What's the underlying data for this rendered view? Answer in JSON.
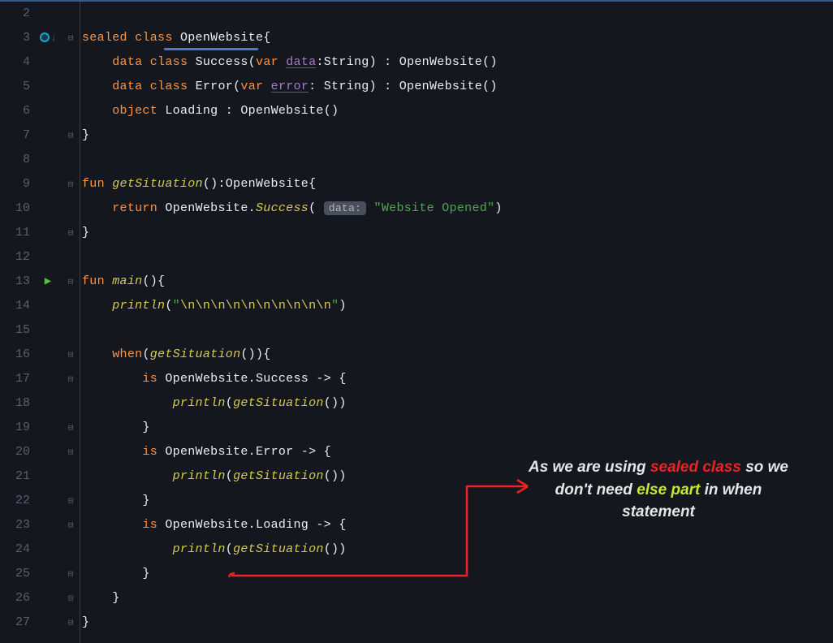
{
  "lines": [
    {
      "num": 2,
      "run": "",
      "fold": "",
      "code": ""
    },
    {
      "num": 3,
      "run": "impl",
      "fold": "open",
      "code": "sealed"
    },
    {
      "num": 4,
      "run": "",
      "fold": "",
      "code": "success"
    },
    {
      "num": 5,
      "run": "",
      "fold": "",
      "code": "error"
    },
    {
      "num": 6,
      "run": "",
      "fold": "",
      "code": "loading"
    },
    {
      "num": 7,
      "run": "",
      "fold": "close",
      "code": "brace"
    },
    {
      "num": 8,
      "run": "",
      "fold": "",
      "code": ""
    },
    {
      "num": 9,
      "run": "",
      "fold": "open",
      "code": "getsit"
    },
    {
      "num": 10,
      "run": "",
      "fold": "",
      "code": "return"
    },
    {
      "num": 11,
      "run": "",
      "fold": "close",
      "code": "brace"
    },
    {
      "num": 12,
      "run": "",
      "fold": "",
      "code": ""
    },
    {
      "num": 13,
      "run": "run",
      "fold": "open",
      "code": "main"
    },
    {
      "num": 14,
      "run": "",
      "fold": "",
      "code": "println_esc"
    },
    {
      "num": 15,
      "run": "",
      "fold": "",
      "code": ""
    },
    {
      "num": 16,
      "run": "",
      "fold": "open",
      "code": "when"
    },
    {
      "num": 17,
      "run": "",
      "fold": "open",
      "code": "is_success"
    },
    {
      "num": 18,
      "run": "",
      "fold": "",
      "code": "println_getsit"
    },
    {
      "num": 19,
      "run": "",
      "fold": "close",
      "code": "brace8"
    },
    {
      "num": 20,
      "run": "",
      "fold": "open",
      "code": "is_error"
    },
    {
      "num": 21,
      "run": "",
      "fold": "",
      "code": "println_getsit"
    },
    {
      "num": 22,
      "run": "",
      "fold": "close",
      "code": "brace8"
    },
    {
      "num": 23,
      "run": "",
      "fold": "open",
      "code": "is_loading"
    },
    {
      "num": 24,
      "run": "",
      "fold": "",
      "code": "println_getsit"
    },
    {
      "num": 25,
      "run": "",
      "fold": "close",
      "code": "brace8"
    },
    {
      "num": 26,
      "run": "",
      "fold": "close",
      "code": "brace4"
    },
    {
      "num": 27,
      "run": "",
      "fold": "close",
      "code": "brace"
    }
  ],
  "tokens": {
    "sealed": "sealed",
    "class": "class",
    "data": "data",
    "var": "var",
    "object": "object",
    "fun": "fun",
    "return": "return",
    "when": "when",
    "is": "is",
    "OpenWebsite": "OpenWebsite",
    "Success": "Success",
    "Error": "Error",
    "Loading": "Loading",
    "String": "String",
    "param_data": "data",
    "param_error": "error",
    "getSituation": "getSituation",
    "main": "main",
    "println": "println",
    "hint_data": "data:",
    "str_website": "\"Website Opened\"",
    "str_esc_open": "\"",
    "esc_seq": "\\n\\n\\n\\n\\n\\n\\n\\n\\n\\n",
    "str_esc_close": "\""
  },
  "annotation": {
    "t1": "As we are using ",
    "t2": "sealed class",
    "t3": " so we don't need ",
    "t4": "else part",
    "t5": " in when statement"
  }
}
